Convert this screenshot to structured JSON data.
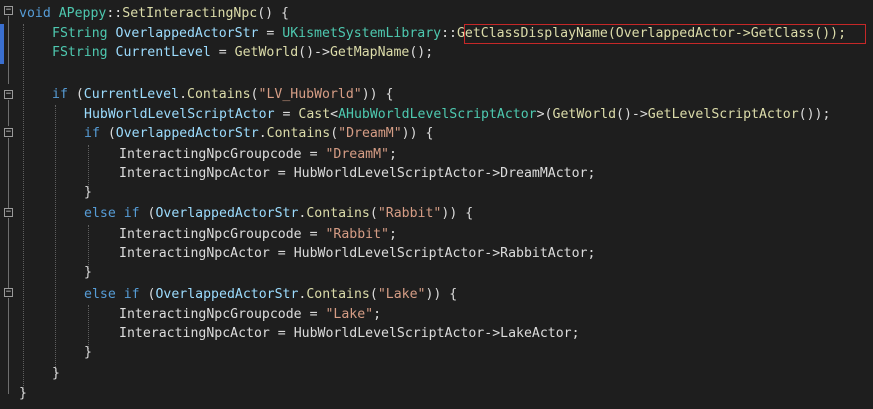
{
  "code": {
    "line1": {
      "kw_void": "void",
      "class_name": "APeppy",
      "scope": "::",
      "func_name": "SetInteractingNpc",
      "rest": "() {"
    },
    "line2": {
      "type": "FString",
      "var": "OverlappedActorStr",
      "op": " = ",
      "lib": "UKismetSystemLibrary",
      "scope": "::",
      "call": "GetClassDisplayName(OverlappedActor->GetClass());"
    },
    "line3": {
      "type": "FString",
      "var": "CurrentLevel",
      "op": " = ",
      "fn1": "GetWorld",
      "mid": "()->",
      "fn2": "GetMapName",
      "end": "();"
    },
    "line4": {
      "kw": "if",
      "open": " (",
      "var": "CurrentLevel",
      "dot": ".",
      "fn": "Contains",
      "p1": "(",
      "str": "\"LV_HubWorld\"",
      "close": ")) {"
    },
    "line5": {
      "var": "HubWorldLevelScriptActor",
      "op": " = ",
      "cast": "Cast",
      "lt": "<",
      "type": "AHubWorldLevelScriptActor",
      "gt": ">(",
      "fn1": "GetWorld",
      "mid": "()->",
      "fn2": "GetLevelScriptActor",
      "end": "());"
    },
    "line6": {
      "kw": "if",
      "open": " (",
      "var": "OverlappedActorStr",
      "dot": ".",
      "fn": "Contains",
      "p1": "(",
      "str": "\"DreamM\"",
      "close": ")) {"
    },
    "line7": {
      "var": "InteractingNpcGroupcode",
      "op": " = ",
      "str": "\"DreamM\"",
      "end": ";"
    },
    "line8": {
      "var": "InteractingNpcActor",
      "op": " = ",
      "var2": "HubWorldLevelScriptActor",
      "arrow": "->",
      "member": "DreamMActor",
      "end": ";"
    },
    "line9": {
      "brace": "}"
    },
    "line10": {
      "kw_else": "else",
      "kw_if": " if",
      "open": " (",
      "var": "OverlappedActorStr",
      "dot": ".",
      "fn": "Contains",
      "p1": "(",
      "str": "\"Rabbit\"",
      "close": ")) {"
    },
    "line11": {
      "var": "InteractingNpcGroupcode",
      "op": " = ",
      "str": "\"Rabbit\"",
      "end": ";"
    },
    "line12": {
      "var": "InteractingNpcActor",
      "op": " = ",
      "var2": "HubWorldLevelScriptActor",
      "arrow": "->",
      "member": "RabbitActor",
      "end": ";"
    },
    "line13": {
      "brace": "}"
    },
    "line14": {
      "kw_else": "else",
      "kw_if": " if",
      "open": " (",
      "var": "OverlappedActorStr",
      "dot": ".",
      "fn": "Contains",
      "p1": "(",
      "str": "\"Lake\"",
      "close": ")) {"
    },
    "line15": {
      "var": "InteractingNpcGroupcode",
      "op": " = ",
      "str": "\"Lake\"",
      "end": ";"
    },
    "line16": {
      "var": "InteractingNpcActor",
      "op": " = ",
      "var2": "HubWorldLevelScriptActor",
      "arrow": "->",
      "member": "LakeActor",
      "end": ";"
    },
    "line17": {
      "brace": "}"
    },
    "line18": {
      "brace": "}"
    },
    "line19": {
      "brace": "}"
    }
  },
  "fold_glyph": "−",
  "colors": {
    "background": "#1e1e1e",
    "keyword": "#569cd6",
    "type": "#4ec9b0",
    "function": "#dcdcaa",
    "variable": "#9cdcfe",
    "string": "#d69d85",
    "highlight_box": "#c62828",
    "change_bar": "#3a6fd0"
  }
}
